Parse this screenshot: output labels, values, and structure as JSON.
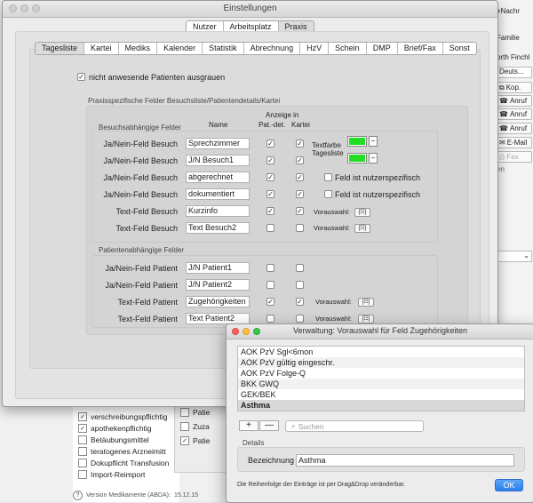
{
  "background": {
    "right_panel": {
      "header": "Familie",
      "item_nachr": "+Nachr",
      "item_finchley": "orth Finchl",
      "item_deutsch": "Deuts...",
      "buttons": [
        "Kop.",
        "Anruf",
        "Anruf",
        "Anruf",
        "E-Mail",
        "Fax"
      ],
      "item_en": "en"
    },
    "list_items": [
      {
        "label": "verschreibungspflichtig",
        "checked": true
      },
      {
        "label": "apothekenpflichtig",
        "checked": true
      },
      {
        "label": "Betäubungsmittel",
        "checked": false
      },
      {
        "label": "teratogenes Arzneimitt",
        "checked": false
      },
      {
        "label": "Dokupflicht Transfusion",
        "checked": false
      },
      {
        "label": "Import-Reimport",
        "checked": false
      }
    ],
    "panel2_items": [
      "Patie",
      "Zuza",
      "Patie"
    ],
    "status_text": "Version Medikamente (ABDA):",
    "status_version": "15.12.15"
  },
  "window": {
    "title": "Einstellungen",
    "top_tabs": [
      {
        "label": "Nutzer",
        "active": false
      },
      {
        "label": "Arbeitsplatz",
        "active": false
      },
      {
        "label": "Praxis",
        "active": true
      }
    ],
    "sub_tabs": [
      {
        "label": "Tagesliste",
        "active": true
      },
      {
        "label": "Kartei",
        "active": false
      },
      {
        "label": "Mediks",
        "active": false
      },
      {
        "label": "Kalender",
        "active": false
      },
      {
        "label": "Statistik",
        "active": false
      },
      {
        "label": "Abrechnung",
        "active": false
      },
      {
        "label": "HzV",
        "active": false
      },
      {
        "label": "Schein",
        "active": false
      },
      {
        "label": "DMP",
        "active": false
      },
      {
        "label": "Brief/Fax",
        "active": false
      },
      {
        "label": "Sonst",
        "active": false
      }
    ],
    "gray_out_label": "nicht anwesende Patienten ausgrauen",
    "section_title": "Praxisspezifische Felder Besuchsliste/Patientendetails/Kartei",
    "group1_title": "Besuchsabhängige Felder",
    "col_name": "Name",
    "col_display": "Anzeige in",
    "col_pat": "Pat.-det.",
    "col_kartei": "Kartei",
    "color_label_1": "Textfarbe",
    "color_label_2": "Tagesliste",
    "color_green": "#22dd22",
    "user_specific_label": "Feld ist nutzerspezifisch",
    "preselect_label": "Vorauswahl:",
    "visit_rows": [
      {
        "label": "Ja/Nein-Feld Besuch",
        "name": "Sprechzimmer",
        "pat": true,
        "kartei": true
      },
      {
        "label": "Ja/Nein-Feld Besuch",
        "name": "J/N Besuch1",
        "pat": true,
        "kartei": true
      },
      {
        "label": "Ja/Nein-Feld Besuch",
        "name": "abgerechnet",
        "pat": true,
        "kartei": true
      },
      {
        "label": "Ja/Nein-Feld Besuch",
        "name": "dokumentiert",
        "pat": true,
        "kartei": true
      },
      {
        "label": "Text-Feld Besuch",
        "name": "Kurzinfo",
        "pat": true,
        "kartei": true
      },
      {
        "label": "Text-Feld Besuch",
        "name": "Text Besuch2",
        "pat": false,
        "kartei": false
      }
    ],
    "group2_title": "Patientenabhängige Felder",
    "patient_rows": [
      {
        "label": "Ja/Nein-Feld Patient",
        "name": "J/N Patient1",
        "pat": false,
        "kartei": false
      },
      {
        "label": "Ja/Nein-Feld Patient",
        "name": "J/N Patient2",
        "pat": false,
        "kartei": false
      },
      {
        "label": "Text-Feld Patient",
        "name": "Zugehörigkeiten",
        "pat": true,
        "kartei": true
      },
      {
        "label": "Text-Feld Patient",
        "name": "Text Patient2",
        "pat": false,
        "kartei": false
      }
    ]
  },
  "dialog": {
    "title": "Verwaltung: Vorauswahl für Feld Zugehörigkeiten",
    "items": [
      {
        "label": "AOK PzV Sgl<6mon",
        "selected": false
      },
      {
        "label": "AOK PzV gültig eingeschr.",
        "selected": false
      },
      {
        "label": "AOK PzV Folge-Q",
        "selected": false
      },
      {
        "label": "BKK GWQ",
        "selected": false
      },
      {
        "label": "GEK/BEK",
        "selected": false
      },
      {
        "label": "Asthma",
        "selected": true
      }
    ],
    "add_label": "+",
    "remove_label": "—",
    "search_placeholder": "Suchen",
    "details_title": "Details",
    "designation_label": "Bezeichnung",
    "designation_value": "Asthma",
    "hint": "Die Reihenfolge der Einträge ist per Drag&Drop veränderbar.",
    "ok_label": "OK"
  }
}
